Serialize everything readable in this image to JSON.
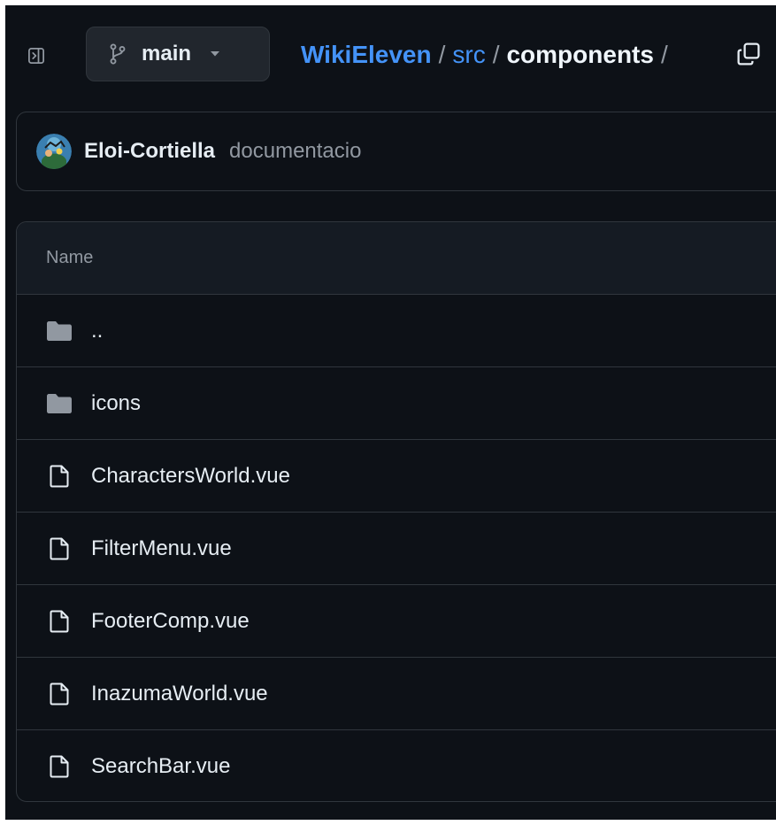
{
  "header": {
    "panel_toggle_icon": "sidebar-expand-icon",
    "branch": {
      "icon": "git-branch-icon",
      "name": "main",
      "caret_icon": "caret-down-icon"
    },
    "breadcrumb": {
      "repo": "WikiEleven",
      "sep1": "/",
      "folder": "src",
      "sep2": "/",
      "current": "components",
      "sep3": "/"
    },
    "copy_icon": "copy-icon"
  },
  "commit": {
    "author": "Eloi-Cortiella",
    "message": "documentacio"
  },
  "files": {
    "column_header": "Name",
    "rows": [
      {
        "name": "..",
        "type": "folder"
      },
      {
        "name": "icons",
        "type": "folder"
      },
      {
        "name": "CharactersWorld.vue",
        "type": "file"
      },
      {
        "name": "FilterMenu.vue",
        "type": "file"
      },
      {
        "name": "FooterComp.vue",
        "type": "file"
      },
      {
        "name": "InazumaWorld.vue",
        "type": "file"
      },
      {
        "name": "SearchBar.vue",
        "type": "file"
      }
    ]
  },
  "colors": {
    "background": "#0d1117",
    "border": "#30363d",
    "link": "#4493f8",
    "text": "#e6edf3",
    "muted": "#9198a1",
    "header_bg": "#151b23"
  }
}
